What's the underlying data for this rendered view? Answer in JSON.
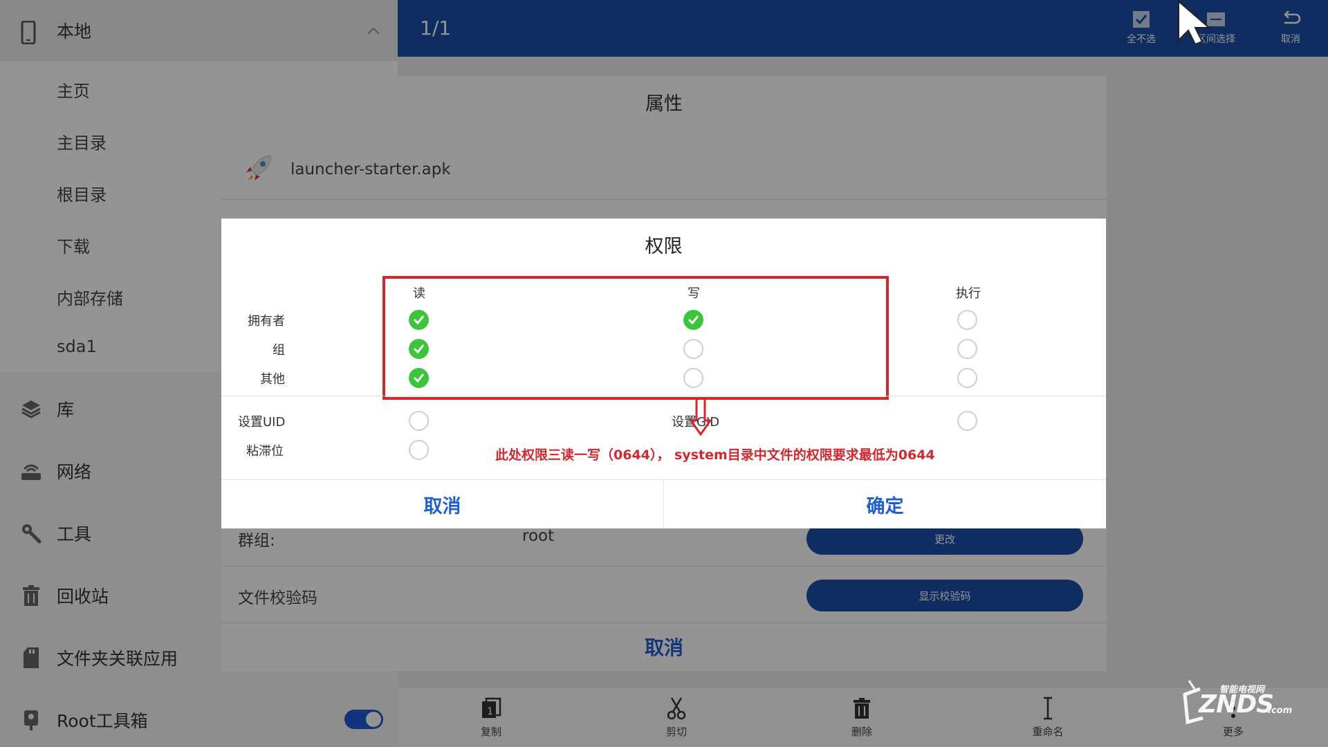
{
  "sidebar": {
    "header_label": "本地",
    "sub_items": [
      "主页",
      "主目录",
      "根目录",
      "下载",
      "内部存储",
      "sda1"
    ],
    "items": [
      {
        "label": "库",
        "icon": "layers-icon"
      },
      {
        "label": "网络",
        "icon": "router-icon"
      },
      {
        "label": "工具",
        "icon": "wrench-icon"
      },
      {
        "label": "回收站",
        "icon": "trash-icon"
      },
      {
        "label": "文件夹关联应用",
        "icon": "sd-card-icon"
      },
      {
        "label": "Root工具箱",
        "icon": "root-key-icon"
      }
    ],
    "root_toggle_on": true
  },
  "topbar": {
    "count": "1/1",
    "actions": [
      {
        "label": "全不选",
        "icon": "checkbox-icon"
      },
      {
        "label": "区间选择",
        "icon": "range-select-icon"
      },
      {
        "label": "取消",
        "icon": "undo-icon"
      }
    ]
  },
  "properties": {
    "title": "属性",
    "file_name": "launcher-starter.apk",
    "group_label": "群组:",
    "group_value": "root",
    "group_button": "更改",
    "checksum_label": "文件校验码",
    "checksum_button": "显示校验码",
    "cancel_label": "取消"
  },
  "bottombar": {
    "actions": [
      {
        "label": "复制",
        "icon": "copy-icon"
      },
      {
        "label": "剪切",
        "icon": "scissors-icon"
      },
      {
        "label": "删除",
        "icon": "trash-icon"
      },
      {
        "label": "重命名",
        "icon": "rename-icon"
      },
      {
        "label": "更多",
        "icon": "more-icon"
      }
    ]
  },
  "permissions_dialog": {
    "title": "权限",
    "columns": [
      "读",
      "写",
      "执行"
    ],
    "rows": [
      {
        "label": "拥有者",
        "values": [
          true,
          true,
          false
        ]
      },
      {
        "label": "组",
        "values": [
          true,
          false,
          false
        ]
      },
      {
        "label": "其他",
        "values": [
          true,
          false,
          false
        ]
      }
    ],
    "set_uid_label": "设置UID",
    "set_uid": false,
    "set_gid_label": "设置GID",
    "set_gid": false,
    "sticky_label": "粘滞位",
    "sticky": false,
    "annotation": "此处权限三读一写（0644），  system目录中文件的权限要求最低为0644",
    "cancel_label": "取消",
    "ok_label": "确定"
  },
  "colors": {
    "accent_blue": "#1a4ea8",
    "button_text_blue": "#1f5fcf",
    "check_green": "#3cc53a",
    "annotation_red": "#d6262c"
  }
}
